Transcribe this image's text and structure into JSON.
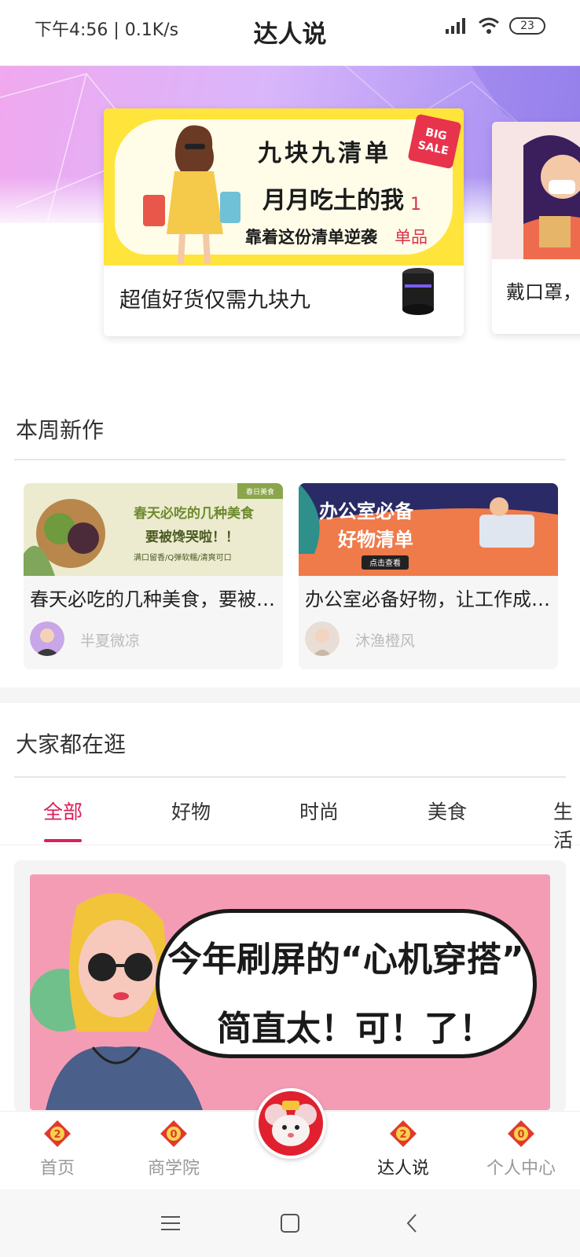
{
  "status_bar": {
    "time_speed": "下午4:56 | 0.1K/s",
    "title": "达人说",
    "battery": "23",
    "icons": [
      "signal-icon",
      "wifi-icon",
      "battery-icon"
    ]
  },
  "banner": {
    "main_card": {
      "image_line1": "九块九清单",
      "image_line2": "月月吃土的我",
      "image_line3": "靠着这份清单逆袭",
      "number": "1",
      "tag": "单品",
      "sale_badge": "BIG SALE",
      "caption": "超值好货仅需九块九"
    },
    "side_card": {
      "caption": "戴口罩，"
    }
  },
  "new_works": {
    "title": "本周新作",
    "items": [
      {
        "image_text_1": "春天必吃的几种美食",
        "image_text_2": "要被馋哭啦！！",
        "image_text_3": "满口留香/Q弹软糯/清爽可口",
        "image_badge": "春日美食",
        "title": "春天必吃的几种美食，要被馋哭啦！！",
        "author": "半夏微凉"
      },
      {
        "image_text_1": "办公室必备",
        "image_text_2": "好物清单",
        "image_text_3": "点击查看",
        "title": "办公室必备好物，让工作成为享受",
        "author": "沐渔橙风"
      }
    ]
  },
  "browse": {
    "title": "大家都在逛",
    "tabs": [
      "全部",
      "好物",
      "时尚",
      "美食",
      "生活"
    ],
    "active_tab": "全部",
    "feed_image": {
      "line1": "今年刷屏的“心机穿搭”",
      "line2": "简直太！可！了！"
    }
  },
  "bottom_nav": {
    "items": [
      {
        "label": "首页",
        "icon": "home-icon"
      },
      {
        "label": "商学院",
        "icon": "academy-icon"
      },
      {
        "label": "达人说",
        "icon": "talent-icon"
      },
      {
        "label": "个人中心",
        "icon": "profile-icon"
      }
    ],
    "center_icon": "mouse-mascot-icon",
    "active": "达人说"
  },
  "system_nav": {
    "buttons": [
      "menu-icon",
      "home-square-icon",
      "back-icon"
    ]
  },
  "colors": {
    "accent": "#d9205a",
    "banner_yellow": "#ffe43b",
    "feed_pink": "#f59cb5",
    "nav_red": "#e0202e"
  }
}
